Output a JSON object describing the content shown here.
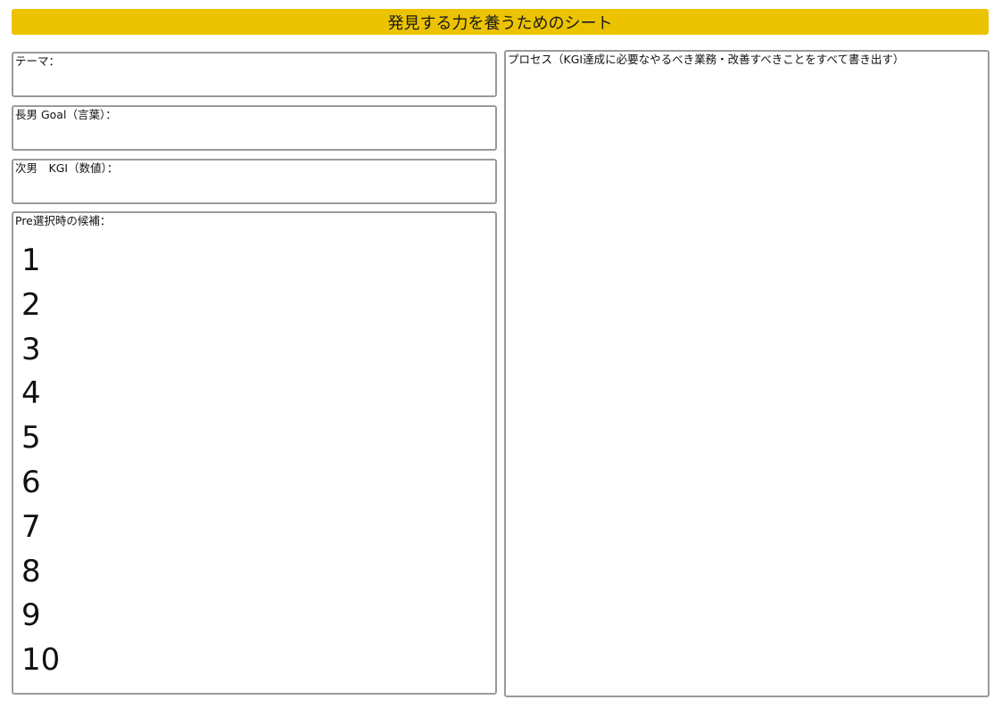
{
  "header": {
    "title": "発見する力を養うためのシート"
  },
  "fields": {
    "theme_label": "テーマ：",
    "goal_label": "長男 Goal（言葉）：",
    "kgi_label": "次男　KGI（数値）：",
    "candidates_label": "Pre選択時の候補：",
    "process_label": "プロセス（KGI達成に必要なやるべき業務・改善すべきことをすべて書き出す）"
  },
  "candidates": {
    "numbers": [
      "1",
      "2",
      "3",
      "4",
      "5",
      "6",
      "7",
      "8",
      "9",
      "10"
    ]
  },
  "colors": {
    "title_bar": "#ecc300",
    "box_border": "#9a9a9a"
  }
}
